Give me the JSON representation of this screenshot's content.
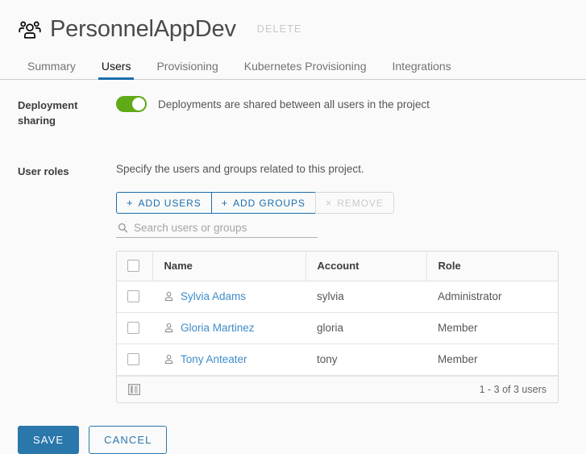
{
  "header": {
    "icon": "users-group-icon",
    "title": "PersonnelAppDev",
    "delete_label": "DELETE"
  },
  "tabs": [
    {
      "label": "Summary",
      "active": false
    },
    {
      "label": "Users",
      "active": true
    },
    {
      "label": "Provisioning",
      "active": false
    },
    {
      "label": "Kubernetes Provisioning",
      "active": false
    },
    {
      "label": "Integrations",
      "active": false
    }
  ],
  "deployment_sharing": {
    "label": "Deployment sharing",
    "toggle_on": true,
    "description": "Deployments are shared between all users in the project"
  },
  "user_roles": {
    "label": "User roles",
    "description": "Specify the users and groups related to this project.",
    "buttons": [
      {
        "symbol": "+",
        "label": "ADD USERS",
        "disabled": false
      },
      {
        "symbol": "+",
        "label": "ADD GROUPS",
        "disabled": false
      },
      {
        "symbol": "×",
        "label": "REMOVE",
        "disabled": true
      }
    ],
    "search": {
      "placeholder": "Search users or groups",
      "value": ""
    },
    "table": {
      "columns": [
        "Name",
        "Account",
        "Role"
      ],
      "rows": [
        {
          "name": "Sylvia Adams",
          "account": "sylvia",
          "role": "Administrator"
        },
        {
          "name": "Gloria Martinez",
          "account": "gloria",
          "role": "Member"
        },
        {
          "name": "Tony Anteater",
          "account": "tony",
          "role": "Member"
        }
      ],
      "footer": {
        "columns_icon": "column-settings-icon",
        "count": "1 - 3 of 3 users"
      }
    }
  },
  "actions": {
    "save_label": "SAVE",
    "cancel_label": "CANCEL"
  },
  "colors": {
    "accent_blue": "#2a77ac",
    "tab_active": "#1b6ead",
    "toggle_green": "#60a917",
    "link_blue": "#3f8cc9",
    "background": "#fafafa"
  }
}
